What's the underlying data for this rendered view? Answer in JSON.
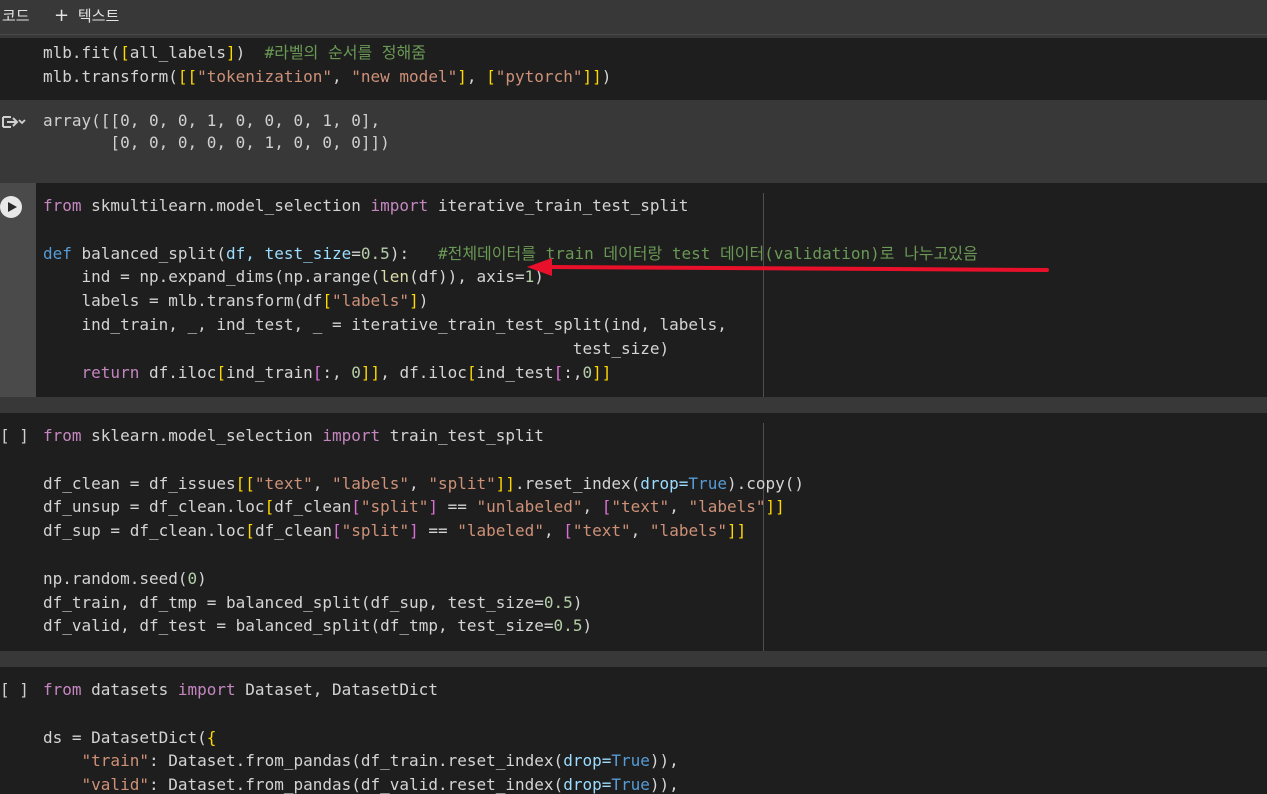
{
  "toolbar": {
    "code_label": "코드",
    "plus": "+",
    "text_label": "텍스트"
  },
  "cells": {
    "prev_code": {
      "lines": [
        [
          {
            "t": "mlb.fit("
          },
          {
            "t": "[",
            "c": "#ffd700"
          },
          {
            "t": "all_labels"
          },
          {
            "t": "]",
            "c": "#ffd700"
          },
          {
            "t": ")  "
          },
          {
            "t": "#라벨의 순서를 정해줌",
            "c": "#6a9955"
          }
        ],
        [
          {
            "t": "mlb.transform("
          },
          {
            "t": "[[",
            "c": "#ffd700"
          },
          {
            "t": "\"tokenization\"",
            "c": "#ce9178"
          },
          {
            "t": ", "
          },
          {
            "t": "\"new model\"",
            "c": "#ce9178"
          },
          {
            "t": "]",
            "c": "#ffd700"
          },
          {
            "t": ", "
          },
          {
            "t": "[",
            "c": "#ffd700"
          },
          {
            "t": "\"pytorch\"",
            "c": "#ce9178"
          },
          {
            "t": "]]",
            "c": "#ffd700"
          },
          {
            "t": ")"
          }
        ]
      ]
    },
    "prev_output": {
      "text": "array([[0, 0, 0, 1, 0, 0, 0, 1, 0],\n       [0, 0, 0, 0, 0, 1, 0, 0, 0]])"
    },
    "cell_split": {
      "lines": [
        [
          {
            "t": "from",
            "c": "#c586c0"
          },
          {
            "t": " skmultilearn.model_selection "
          },
          {
            "t": "import",
            "c": "#c586c0"
          },
          {
            "t": " iterative_train_test_split"
          }
        ],
        [],
        [
          {
            "t": "def",
            "c": "#569cd6"
          },
          {
            "t": " balanced_split("
          },
          {
            "t": "df, test_size",
            "c": "#9cdcfe"
          },
          {
            "t": "="
          },
          {
            "t": "0.5",
            "c": "#b5cea8"
          },
          {
            "t": "):   "
          },
          {
            "t": "#전체데이터를 train 데이터랑 test 데이터(validation)로 나누고있음",
            "c": "#6a9955"
          }
        ],
        [
          {
            "t": "    ind = np.expand_dims("
          },
          {
            "t": "np.arange("
          },
          {
            "t": "len",
            "c": "#dcdcaa"
          },
          {
            "t": "(df)"
          },
          {
            "t": "), axis="
          },
          {
            "t": "1",
            "c": "#b5cea8"
          },
          {
            "t": ")"
          }
        ],
        [
          {
            "t": "    labels = mlb.transform(df"
          },
          {
            "t": "[",
            "c": "#ffd700"
          },
          {
            "t": "\"labels\"",
            "c": "#ce9178"
          },
          {
            "t": "]",
            "c": "#ffd700"
          },
          {
            "t": ")"
          }
        ],
        [
          {
            "t": "    ind_train, _, ind_test, _ = iterative_train_test_split("
          },
          {
            "t": "ind, labels,"
          }
        ],
        [
          {
            "t": "                                                       test_size)"
          }
        ],
        [
          {
            "t": "    "
          },
          {
            "t": "return",
            "c": "#c586c0"
          },
          {
            "t": " df.iloc"
          },
          {
            "t": "[",
            "c": "#ffd700"
          },
          {
            "t": "ind_train"
          },
          {
            "t": "[",
            "c": "#da70d6"
          },
          {
            "t": ":, "
          },
          {
            "t": "0",
            "c": "#b5cea8"
          },
          {
            "t": "]]",
            "c": "#ffd700"
          },
          {
            "t": ", df.iloc"
          },
          {
            "t": "[",
            "c": "#ffd700"
          },
          {
            "t": "ind_test"
          },
          {
            "t": "[",
            "c": "#da70d6"
          },
          {
            "t": ":,"
          },
          {
            "t": "0",
            "c": "#b5cea8"
          },
          {
            "t": "]]",
            "c": "#ffd700"
          }
        ]
      ]
    },
    "cell_sklearn": {
      "bracket": "[ ]",
      "lines": [
        [
          {
            "t": "from",
            "c": "#c586c0"
          },
          {
            "t": " sklearn.model_selection "
          },
          {
            "t": "import",
            "c": "#c586c0"
          },
          {
            "t": " train_test_split"
          }
        ],
        [],
        [
          {
            "t": "df_clean = df_issues"
          },
          {
            "t": "[[",
            "c": "#ffd700"
          },
          {
            "t": "\"text\"",
            "c": "#ce9178"
          },
          {
            "t": ", "
          },
          {
            "t": "\"labels\"",
            "c": "#ce9178"
          },
          {
            "t": ", "
          },
          {
            "t": "\"split\"",
            "c": "#ce9178"
          },
          {
            "t": "]]",
            "c": "#ffd700"
          },
          {
            "t": ".reset_index("
          },
          {
            "t": "drop=",
            "c": "#9cdcfe"
          },
          {
            "t": "True",
            "c": "#569cd6"
          },
          {
            "t": ").copy()"
          }
        ],
        [
          {
            "t": "df_unsup = df_clean.loc"
          },
          {
            "t": "[",
            "c": "#ffd700"
          },
          {
            "t": "df_clean"
          },
          {
            "t": "[",
            "c": "#da70d6"
          },
          {
            "t": "\"split\"",
            "c": "#ce9178"
          },
          {
            "t": "]",
            "c": "#da70d6"
          },
          {
            "t": " == "
          },
          {
            "t": "\"unlabeled\"",
            "c": "#ce9178"
          },
          {
            "t": ", "
          },
          {
            "t": "[",
            "c": "#da70d6"
          },
          {
            "t": "\"text\"",
            "c": "#ce9178"
          },
          {
            "t": ", "
          },
          {
            "t": "\"labels\"",
            "c": "#ce9178"
          },
          {
            "t": "]]",
            "c": "#ffd700"
          }
        ],
        [
          {
            "t": "df_sup = df_clean.loc"
          },
          {
            "t": "[",
            "c": "#ffd700"
          },
          {
            "t": "df_clean"
          },
          {
            "t": "[",
            "c": "#da70d6"
          },
          {
            "t": "\"split\"",
            "c": "#ce9178"
          },
          {
            "t": "]",
            "c": "#da70d6"
          },
          {
            "t": " == "
          },
          {
            "t": "\"labeled\"",
            "c": "#ce9178"
          },
          {
            "t": ", "
          },
          {
            "t": "[",
            "c": "#da70d6"
          },
          {
            "t": "\"text\"",
            "c": "#ce9178"
          },
          {
            "t": ", "
          },
          {
            "t": "\"labels\"",
            "c": "#ce9178"
          },
          {
            "t": "]]",
            "c": "#ffd700"
          }
        ],
        [],
        [
          {
            "t": "np.random.seed("
          },
          {
            "t": "0",
            "c": "#b5cea8"
          },
          {
            "t": ")"
          }
        ],
        [
          {
            "t": "df_train, df_tmp = balanced_split("
          },
          {
            "t": "df_sup, test_size="
          },
          {
            "t": "0.5",
            "c": "#b5cea8"
          },
          {
            "t": ")"
          }
        ],
        [
          {
            "t": "df_valid, df_test = balanced_split("
          },
          {
            "t": "df_tmp, test_size="
          },
          {
            "t": "0.5",
            "c": "#b5cea8"
          },
          {
            "t": ")"
          }
        ]
      ]
    },
    "cell_datasets": {
      "bracket": "[ ]",
      "lines": [
        [
          {
            "t": "from",
            "c": "#c586c0"
          },
          {
            "t": " datasets "
          },
          {
            "t": "import",
            "c": "#c586c0"
          },
          {
            "t": " Dataset, DatasetDict"
          }
        ],
        [],
        [
          {
            "t": "ds = DatasetDict("
          },
          {
            "t": "{",
            "c": "#ffd700"
          }
        ],
        [
          {
            "t": "    "
          },
          {
            "t": "\"train\"",
            "c": "#ce9178"
          },
          {
            "t": ": Dataset.from_pandas("
          },
          {
            "t": "df_train.reset_index("
          },
          {
            "t": "drop=",
            "c": "#9cdcfe"
          },
          {
            "t": "True",
            "c": "#569cd6"
          },
          {
            "t": ")),"
          }
        ],
        [
          {
            "t": "    "
          },
          {
            "t": "\"valid\"",
            "c": "#ce9178"
          },
          {
            "t": ": Dataset.from_pandas("
          },
          {
            "t": "df_valid.reset_index("
          },
          {
            "t": "drop=",
            "c": "#9cdcfe"
          },
          {
            "t": "True",
            "c": "#569cd6"
          },
          {
            "t": ")),"
          }
        ]
      ]
    }
  },
  "annotation": {
    "color": "#e8102a"
  },
  "icons": {
    "output": "output-toggle-icon",
    "run": "run-cell-icon"
  }
}
